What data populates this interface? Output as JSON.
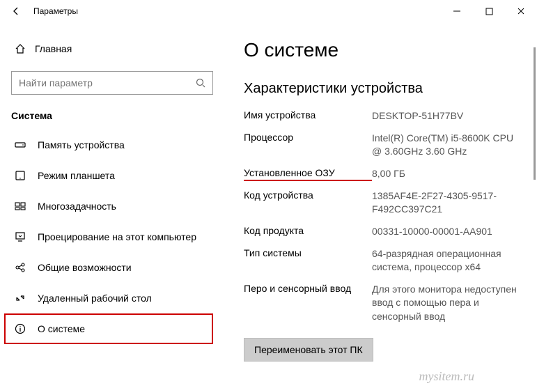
{
  "titlebar": {
    "title": "Параметры"
  },
  "sidebar": {
    "home": "Главная",
    "search_placeholder": "Найти параметр",
    "group": "Система",
    "items": [
      {
        "label": "Память устройства"
      },
      {
        "label": "Режим планшета"
      },
      {
        "label": "Многозадачность"
      },
      {
        "label": "Проецирование на этот компьютер"
      },
      {
        "label": "Общие возможности"
      },
      {
        "label": "Удаленный рабочий стол"
      },
      {
        "label": "О системе"
      }
    ]
  },
  "content": {
    "title": "О системе",
    "section": "Характеристики устройства",
    "specs": {
      "device_name_label": "Имя устройства",
      "device_name_value": "DESKTOP-51H77BV",
      "cpu_label": "Процессор",
      "cpu_value": "Intel(R) Core(TM) i5-8600K CPU @ 3.60GHz   3.60 GHz",
      "ram_label": "Установленное ОЗУ",
      "ram_value": "8,00 ГБ",
      "device_id_label": "Код устройства",
      "device_id_value": "1385AF4E-2F27-4305-9517-F492CC397C21",
      "product_id_label": "Код продукта",
      "product_id_value": "00331-10000-00001-AA901",
      "system_type_label": "Тип системы",
      "system_type_value": "64-разрядная операционная система, процессор x64",
      "pen_label": "Перо и сенсорный ввод",
      "pen_value": "Для этого монитора недоступен ввод с помощью пера и сенсорный ввод"
    },
    "rename_button": "Переименовать этот ПК"
  },
  "watermark": "mysitem.ru"
}
